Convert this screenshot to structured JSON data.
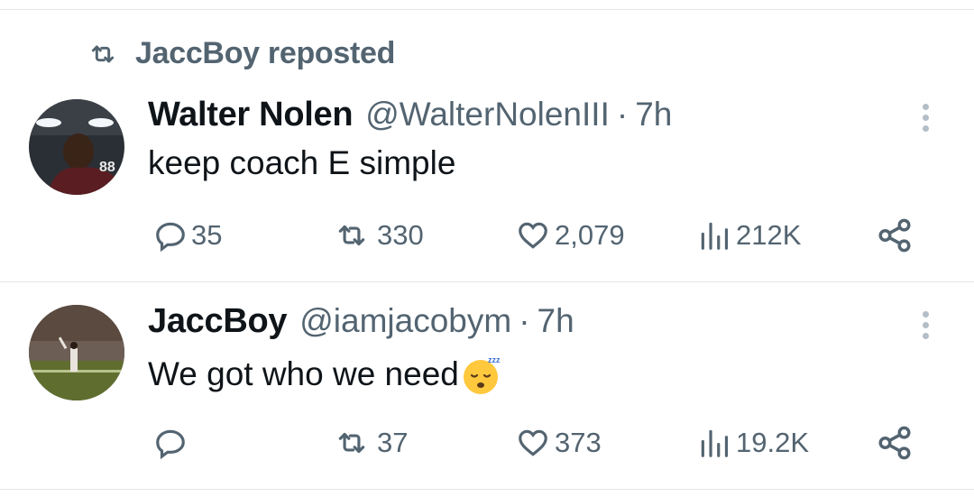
{
  "repost_header": {
    "label": "JaccBoy reposted"
  },
  "tweets": [
    {
      "name": "Walter Nolen",
      "handle": "@WalterNolenIII",
      "dot": "·",
      "time": "7h",
      "text": "keep coach E simple",
      "replies": "35",
      "reposts": "330",
      "likes": "2,079",
      "views": "212K"
    },
    {
      "name": "JaccBoy",
      "handle": "@iamjacobym",
      "dot": "·",
      "time": "7h",
      "text": "We got who we need",
      "emoji": "😴",
      "replies": "",
      "reposts": "37",
      "likes": "373",
      "views": "19.2K"
    }
  ],
  "colors": {
    "secondary_text": "#536471",
    "primary_text": "#0f1419",
    "divider": "#e1e6ea"
  }
}
